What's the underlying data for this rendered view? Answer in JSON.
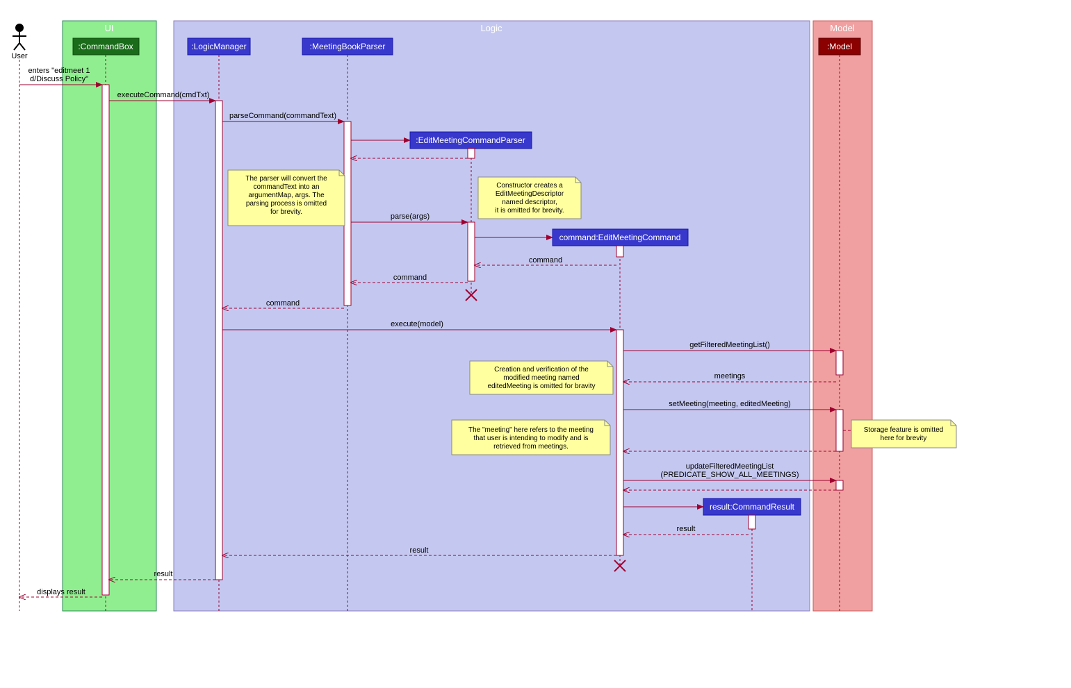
{
  "actor": {
    "name": "User"
  },
  "regions": {
    "ui": {
      "title": "UI"
    },
    "logic": {
      "title": "Logic"
    },
    "model": {
      "title": "Model"
    }
  },
  "participants": {
    "commandBox": ":CommandBox",
    "logicManager": ":LogicManager",
    "meetingBookParser": ":MeetingBookParser",
    "editMeetingCommandParser": ":EditMeetingCommandParser",
    "editMeetingCommand": "command:EditMeetingCommand",
    "model": ":Model",
    "commandResult": "result:CommandResult"
  },
  "messages": {
    "m1a": "enters \"editmeet 1",
    "m1b": "d/Discuss Policy\"",
    "m2": "executeCommand(cmdTxt)",
    "m3": "parseCommand(commandText)",
    "m4": "parse(args)",
    "m5": "command",
    "m6": "command",
    "m7": "command",
    "m8": "execute(model)",
    "m9": "getFilteredMeetingList()",
    "m10": "meetings",
    "m11": "setMeeting(meeting, editedMeeting)",
    "m12a": "updateFilteredMeetingList",
    "m12b": "(PREDICATE_SHOW_ALL_MEETINGS)",
    "m13": "result",
    "m14": "result",
    "m15": "result",
    "m16": "displays result"
  },
  "notes": {
    "n1a": "The parser will convert the",
    "n1b": "commandText into an",
    "n1c": "argumentMap, args. The",
    "n1d": "parsing process is omitted",
    "n1e": "for brevity.",
    "n2a": "Constructor creates a",
    "n2b": "EditMeetingDescriptor",
    "n2c": "named descriptor,",
    "n2d": "it is omitted for brevity.",
    "n3a": "Creation and verification of the",
    "n3b": "modified meeting named",
    "n3c": "editedMeeting is omitted for bravity",
    "n4a": "The \"meeting\" here refers to the meeting",
    "n4b": "that user is intending to modify and is",
    "n4c": "retrieved from meetings.",
    "n5a": "Storage feature is omitted",
    "n5b": "here for brevity"
  }
}
